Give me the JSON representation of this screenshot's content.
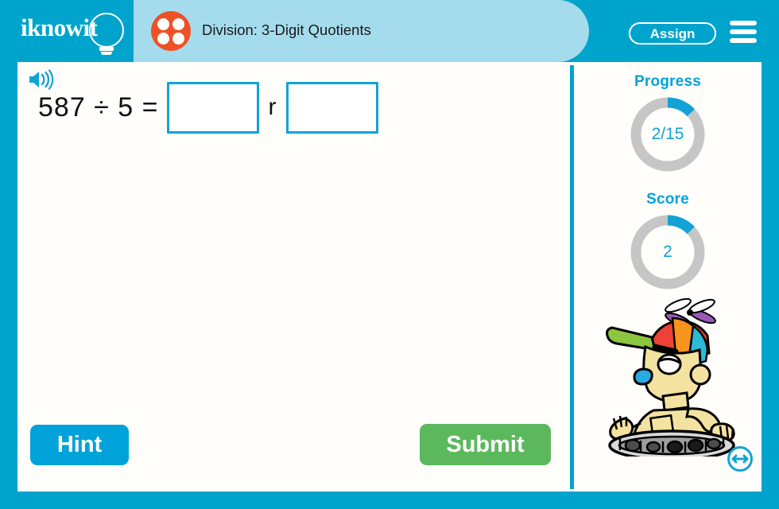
{
  "app": {
    "logo_text": "iknowit",
    "brand_blue": "#00a3cc",
    "accent_blue": "#12a3d6",
    "pill_blue": "#a5dced",
    "orange": "#ef5126",
    "green": "#5cb85c"
  },
  "header": {
    "title": "Division: 3-Digit Quotients",
    "assign_label": "Assign",
    "menu_icon": "hamburger-menu-icon",
    "lesson_icon": "four-dot-circle-icon"
  },
  "problem": {
    "speaker_icon": "speaker-audio-icon",
    "expression": "587 ÷ 5 =",
    "dividend": 587,
    "divisor": 5,
    "quotient_value": "",
    "quotient_placeholder": "",
    "remainder_separator": "r",
    "remainder_value": "",
    "remainder_placeholder": ""
  },
  "actions": {
    "hint_label": "Hint",
    "submit_label": "Submit"
  },
  "sidebar": {
    "progress": {
      "label": "Progress",
      "value": "2/15",
      "completed": 2,
      "total": 15,
      "percent": 13
    },
    "score": {
      "label": "Score",
      "value": "2",
      "percent": 13
    },
    "mascot_icon": "robot-mascot-propeller-hat",
    "nav_icon": "move-resize-arrows-icon"
  }
}
